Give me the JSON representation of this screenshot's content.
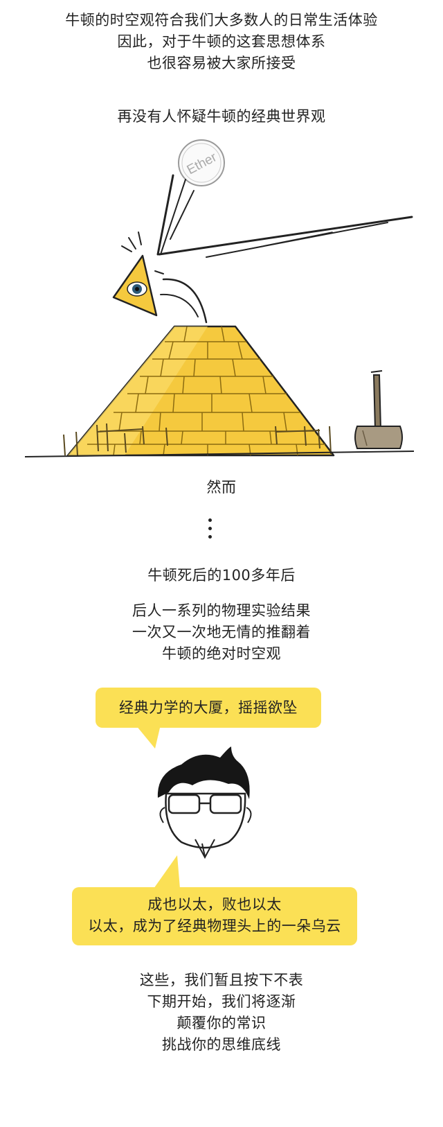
{
  "intro": {
    "lines": [
      "牛顿的时空观符合我们大多数人的日常生活体验",
      "因此，对于牛顿的这套思想体系",
      "也很容易被大家所接受"
    ]
  },
  "no_doubt": "再没有人怀疑牛顿的经典世界观",
  "illustration": {
    "ether_label": "Ether"
  },
  "however": "然而",
  "ellipsis_icon": "vertical-ellipsis",
  "century_later": "牛顿死后的100多年后",
  "experiments": {
    "lines": [
      "后人一系列的物理实验结果",
      "一次又一次地无情的推翻着",
      "牛顿的绝对时空观"
    ]
  },
  "bubble_top": "经典力学的大厦，摇摇欲坠",
  "bubble_bottom": {
    "lines": [
      "成也以太，败也以太",
      "以太，成为了经典物理头上的一朵乌云"
    ]
  },
  "closing": {
    "lines": [
      "这些，我们暂且按下不表",
      "下期开始，我们将逐渐",
      "颠覆你的常识",
      "挑战你的思维底线"
    ]
  },
  "colors": {
    "bubble": "#fbe055",
    "pyramid": "#f5c93e",
    "text": "#222222"
  }
}
